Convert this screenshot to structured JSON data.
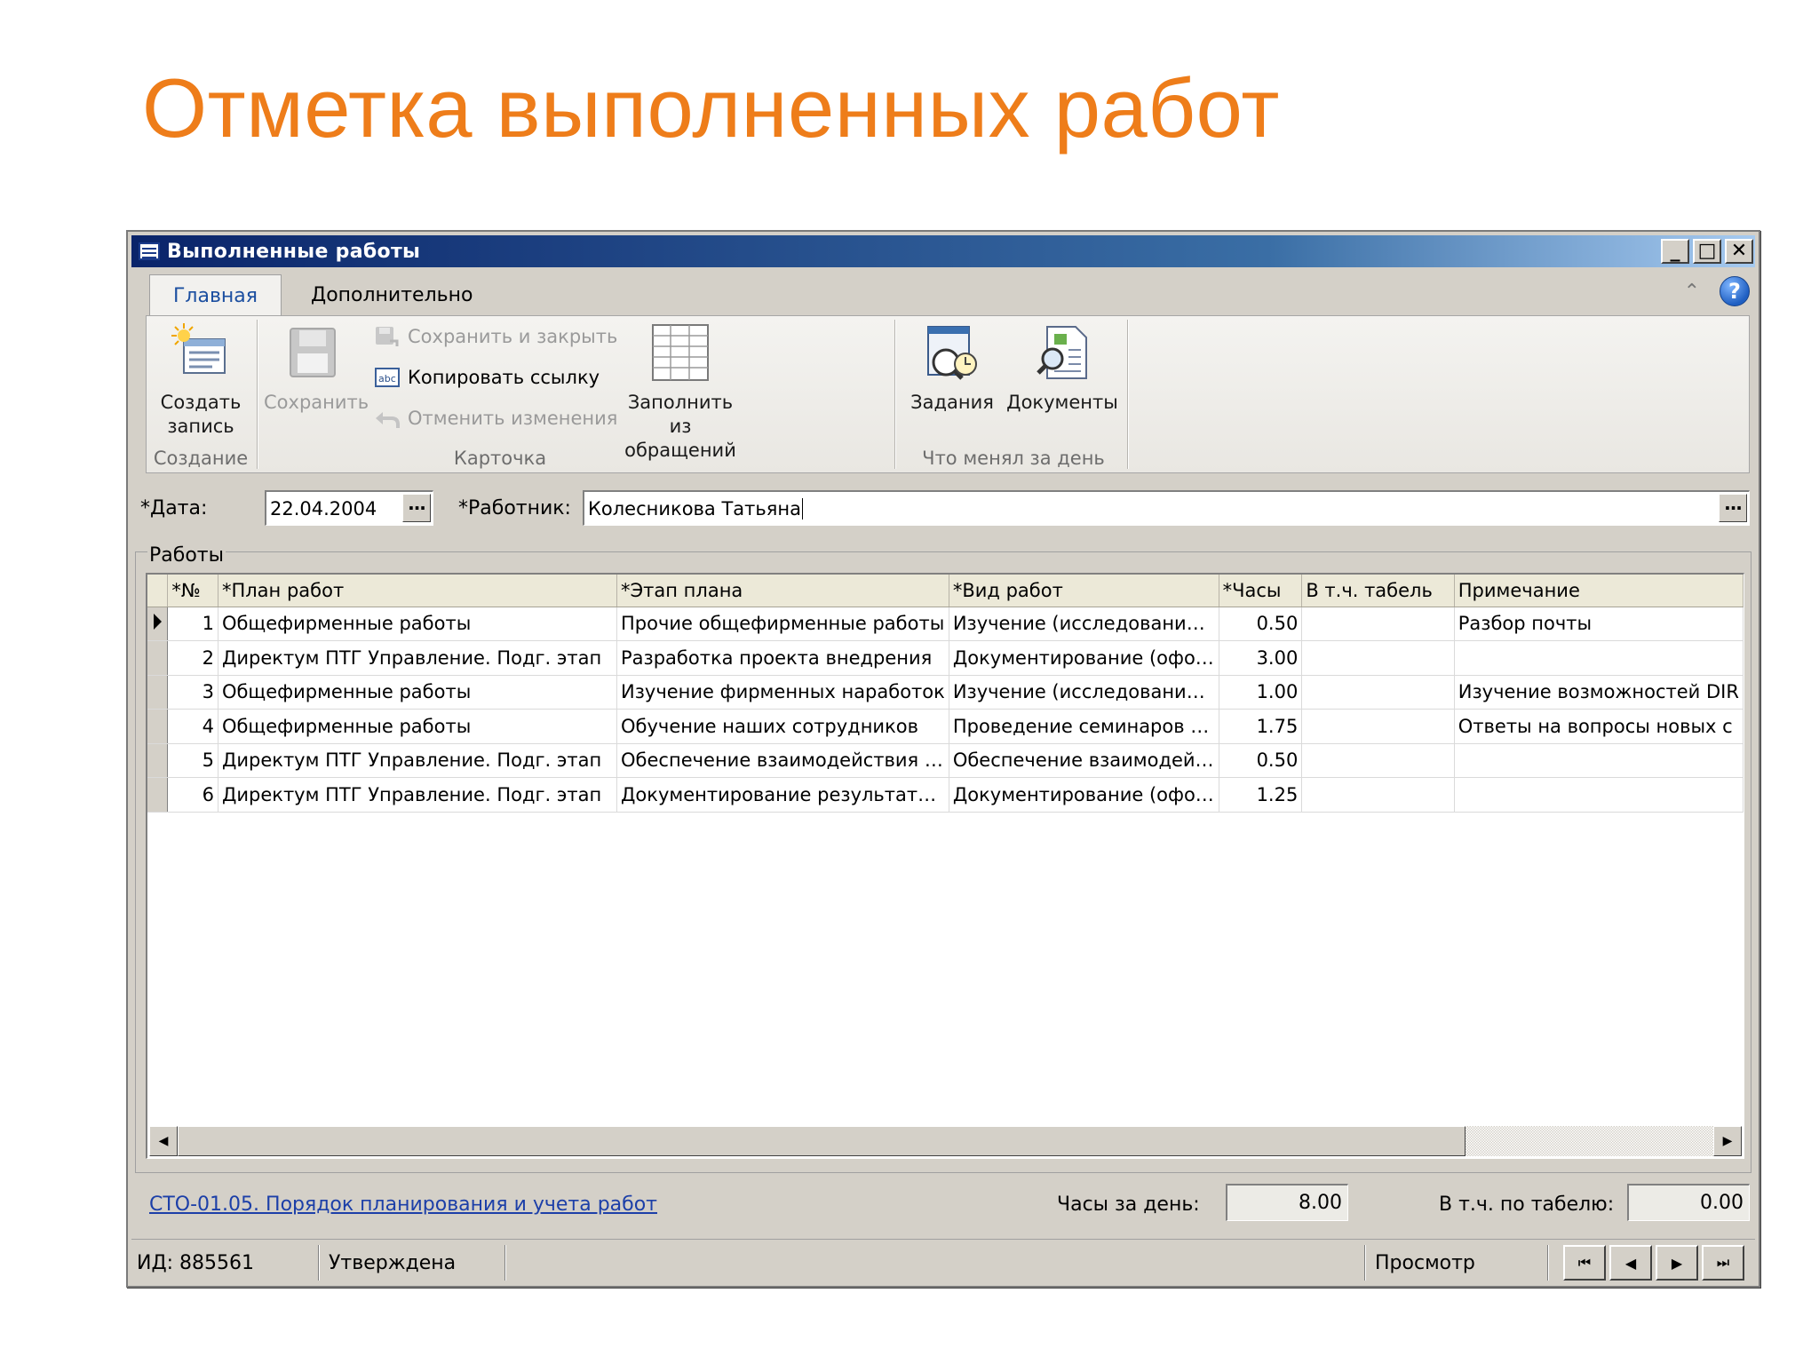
{
  "slide": {
    "title": "Отметка выполненных работ"
  },
  "window": {
    "title": "Выполненные работы",
    "controls": {
      "minimize": "_",
      "maximize": "□",
      "close": "✕"
    }
  },
  "tabs": [
    {
      "label": "Главная",
      "active": true
    },
    {
      "label": "Дополнительно",
      "active": false
    }
  ],
  "ribbon": {
    "groups": {
      "create": {
        "label": "Создание",
        "buttons": {
          "create": "Создать\nзапись"
        }
      },
      "card": {
        "label": "Карточка",
        "save": "Сохранить",
        "save_close": "Сохранить и закрыть",
        "copy_link": "Копировать ссылку",
        "cancel_changes": "Отменить изменения",
        "fill_from": "Заполнить из\nобращений"
      },
      "day": {
        "label": "Что менял за день",
        "tasks": "Задания",
        "documents": "Документы"
      }
    }
  },
  "form": {
    "date_label": "*Дата:",
    "date_value": "22.04.2004",
    "worker_label": "*Работник:",
    "worker_value": "Колесникова Татьяна",
    "ellipsis": "···"
  },
  "works": {
    "group_label": "Работы",
    "columns": [
      "*№",
      "*План работ",
      "*Этап плана",
      "*Вид работ",
      "*Часы",
      "В т.ч. табель",
      "Примечание"
    ],
    "rows": [
      {
        "n": "1",
        "plan": "Общефирменные работы",
        "stage": "Прочие общефирменные работы",
        "kind": "Изучение (исследовани…",
        "hours": "0.50",
        "tab": "",
        "note": "Разбор почты"
      },
      {
        "n": "2",
        "plan": "Директум ПТГ Управление. Подг. этап",
        "stage": "Разработка проекта внедрения",
        "kind": "Документирование (офо…",
        "hours": "3.00",
        "tab": "",
        "note": ""
      },
      {
        "n": "3",
        "plan": "Общефирменные работы",
        "stage": "Изучение фирменных наработок",
        "kind": "Изучение (исследовани…",
        "hours": "1.00",
        "tab": "",
        "note": "Изучение возможностей DIR"
      },
      {
        "n": "4",
        "plan": "Общефирменные работы",
        "stage": "Обучение наших сотрудников",
        "kind": "Проведение семинаров …",
        "hours": "1.75",
        "tab": "",
        "note": "Ответы на вопросы новых с"
      },
      {
        "n": "5",
        "plan": "Директум ПТГ Управление. Подг. этап",
        "stage": "Обеспечение взаимодействия …",
        "kind": "Обеспечение взаимодей…",
        "hours": "0.50",
        "tab": "",
        "note": ""
      },
      {
        "n": "6",
        "plan": "Директум ПТГ Управление. Подг. этап",
        "stage": "Документирование результат…",
        "kind": "Документирование (офо…",
        "hours": "1.25",
        "tab": "",
        "note": ""
      }
    ]
  },
  "footer": {
    "link": "СТО-01.05. Порядок планирования и учета работ",
    "hours_label": "Часы за день:",
    "hours_value": "8.00",
    "tab_label": "В т.ч. по табелю:",
    "tab_value": "0.00"
  },
  "status": {
    "id": "ИД: 885561",
    "state": "Утверждена",
    "mode": "Просмотр"
  }
}
